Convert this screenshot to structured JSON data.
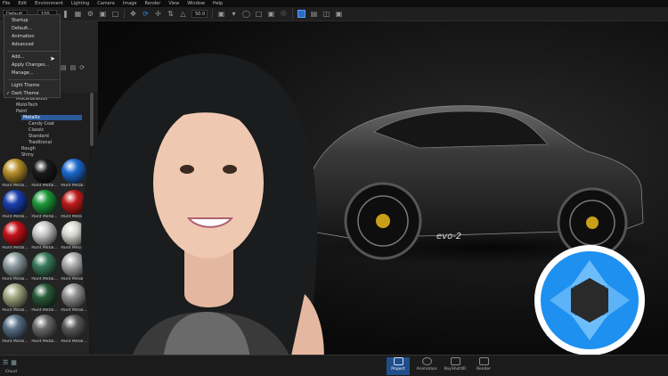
{
  "menubar": {
    "items": [
      "File",
      "Edit",
      "Environment",
      "Lighting",
      "Camera",
      "Image",
      "Render",
      "View",
      "Window",
      "Help"
    ]
  },
  "toolbar": {
    "preset": "Default",
    "zoom": "100 %",
    "value": "50.0"
  },
  "workspace_menu": {
    "items": [
      "Startup",
      "Default...",
      "Animation",
      "Advanced"
    ],
    "add": "Add...",
    "apply": "Apply Changes...",
    "manage": "Manage...",
    "light_theme": "Light Theme",
    "dark_theme": "Dark Theme"
  },
  "library_tree": {
    "items": [
      "Miscellaneous",
      "Mold-Tech",
      "Paint",
      "Metallic",
      "Candy Coat",
      "Classic",
      "Standard",
      "Traditional",
      "Rough",
      "Shiny"
    ],
    "selected": "Metallic"
  },
  "materials": {
    "label": "Paint Metal...",
    "colors": [
      "#b8902a",
      "#1a1a1a",
      "#1d6bd1",
      "#1a3fb0",
      "#1e9a3a",
      "#c01a1a",
      "#c4121a",
      "#c9c9c9",
      "#d8d8d0",
      "#8d9ca0",
      "#3a7a5a",
      "#a8a8a8",
      "#a0a880",
      "#2a5a3a",
      "#909090",
      "#5a7088",
      "#6a6a6a",
      "#5a5a5a"
    ]
  },
  "car": {
    "badge": "evo-2"
  },
  "bottombar": {
    "buttons": [
      {
        "label": "Project",
        "active": true
      },
      {
        "label": "Animation",
        "active": false
      },
      {
        "label": "KeyShotXR",
        "active": false
      },
      {
        "label": "Render",
        "active": false
      }
    ],
    "left_label": "Cloud"
  },
  "colors": {
    "accent": "#2d8df0",
    "logo_blue": "#1e90f0"
  }
}
